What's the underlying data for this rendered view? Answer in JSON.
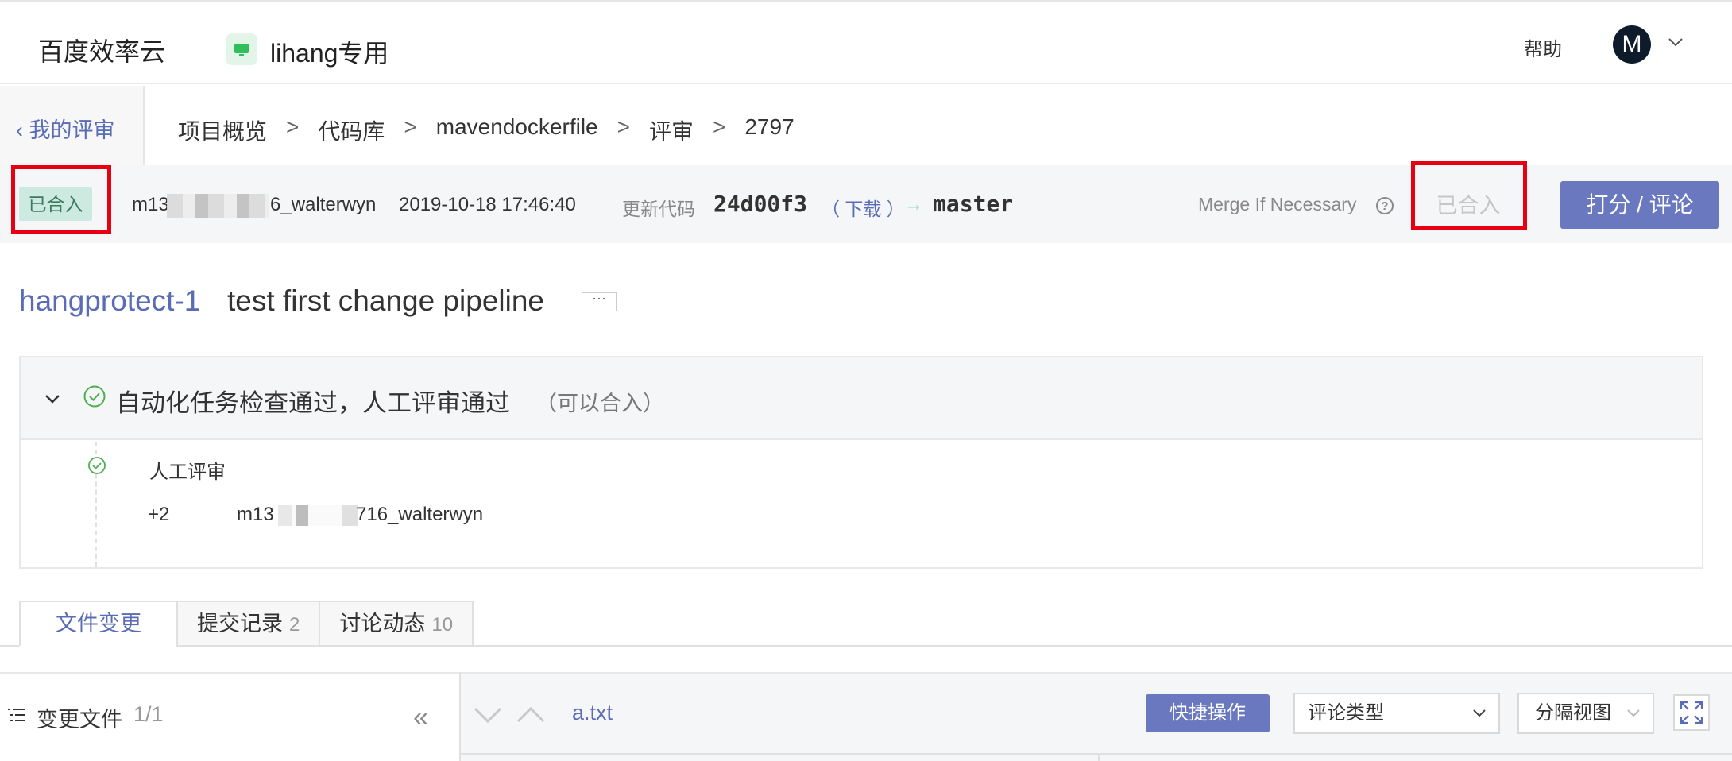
{
  "header": {
    "brand": "百度效率云",
    "project": "lihang专用",
    "help": "帮助",
    "avatar_letter": "M"
  },
  "breadcrumb": {
    "back": "我的评审",
    "items": [
      "项目概览",
      "代码库",
      "mavendockerfile",
      "评审",
      "2797"
    ],
    "sep": ">"
  },
  "status": {
    "badge": "已合入",
    "author_prefix": "m13",
    "author_suffix": "6_walterwyn",
    "time": "2019-10-18 17:46:40",
    "update_label": "更新代码",
    "commit": "24d00f3",
    "download": "（ 下载 ）",
    "arrow": "→",
    "branch": "master",
    "merge_strategy": "Merge If Necessary",
    "merged_button": "已合入",
    "review_button": "打分 / 评论"
  },
  "title": {
    "id": "hangprotect-1",
    "text": "test first change pipeline",
    "more": "···"
  },
  "checks": {
    "title": "自动化任务检查通过，人工评审通过",
    "subtitle": "（可以合入）",
    "manual_title": "人工评审",
    "score": "+2",
    "reviewer_prefix": "m13",
    "reviewer_suffix": "716_walterwyn"
  },
  "tabs": [
    {
      "label": "文件变更",
      "count": ""
    },
    {
      "label": "提交记录",
      "count": "2"
    },
    {
      "label": "讨论动态",
      "count": "10"
    }
  ],
  "files": {
    "label": "变更文件",
    "count": "1/1",
    "collapse": "«",
    "current_file": "a.txt",
    "quick_action": "快捷操作",
    "comment_type": "评论类型",
    "view_mode": "分隔视图"
  },
  "colors": {
    "accent": "#5a6cb5",
    "button": "#6a78bf",
    "merged_badge_bg": "#cdeae0",
    "highlight_red": "#e60012",
    "success": "#4caf50"
  }
}
